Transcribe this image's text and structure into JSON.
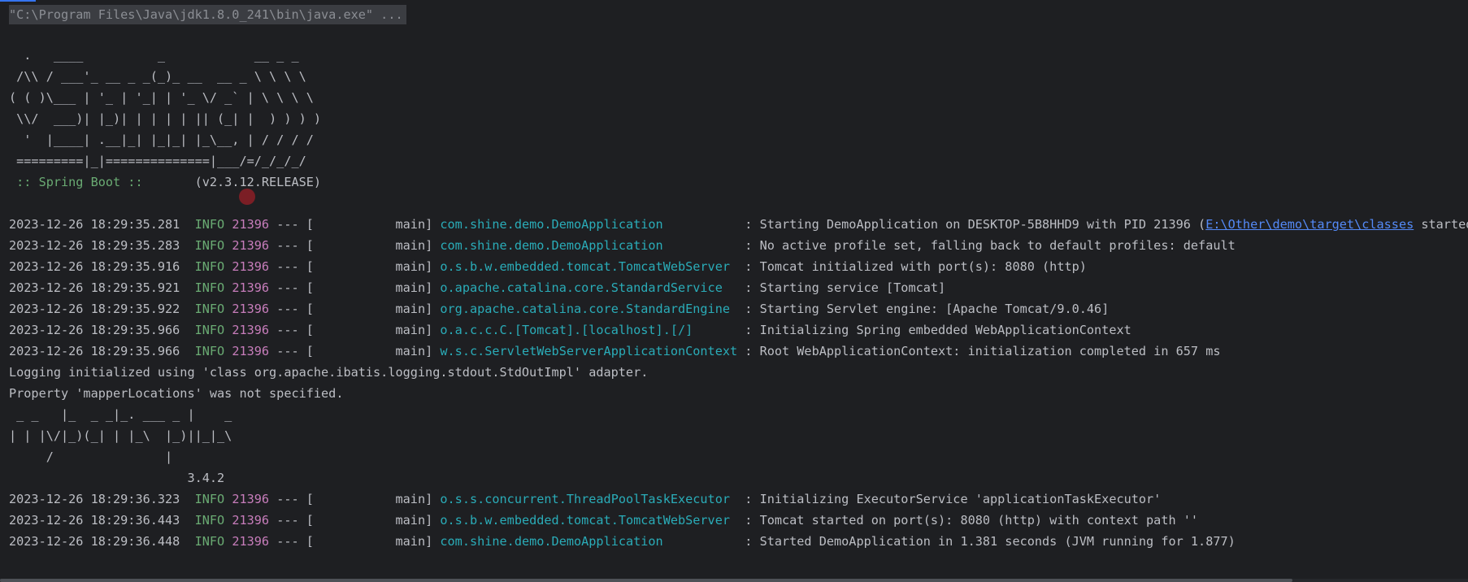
{
  "command": "\"C:\\Program Files\\Java\\jdk1.8.0_241\\bin\\java.exe\" ...",
  "spring_banner": [
    "  .   ____          _            __ _ _",
    " /\\\\ / ___'_ __ _ _(_)_ __  __ _ \\ \\ \\ \\",
    "( ( )\\___ | '_ | '_| | '_ \\/ _` | \\ \\ \\ \\",
    " \\\\/  ___)| |_)| | | | | || (_| |  ) ) ) )",
    "  '  |____| .__|_| |_|_| |_\\__, | / / / /",
    " =========|_|==============|___/=/_/_/_/"
  ],
  "spring_boot": {
    "label": " :: Spring Boot :: ",
    "version": "      (v2.3.12.RELEASE)"
  },
  "logs_a": [
    {
      "ts": "2023-12-26 18:29:35.281",
      "level": "INFO",
      "pid": "21396",
      "sep": " --- [",
      "thread": "           main] ",
      "logger": "com.shine.demo.DemoApplication          ",
      "msg": " : Starting DemoApplication on DESKTOP-5B8HHD9 with PID 21396 (",
      "link": "E:\\Other\\demo\\target\\classes",
      "tail": " started b"
    },
    {
      "ts": "2023-12-26 18:29:35.283",
      "level": "INFO",
      "pid": "21396",
      "sep": " --- [",
      "thread": "           main] ",
      "logger": "com.shine.demo.DemoApplication          ",
      "msg": " : No active profile set, falling back to default profiles: default"
    },
    {
      "ts": "2023-12-26 18:29:35.916",
      "level": "INFO",
      "pid": "21396",
      "sep": " --- [",
      "thread": "           main] ",
      "logger": "o.s.b.w.embedded.tomcat.TomcatWebServer ",
      "msg": " : Tomcat initialized with port(s): 8080 (http)"
    },
    {
      "ts": "2023-12-26 18:29:35.921",
      "level": "INFO",
      "pid": "21396",
      "sep": " --- [",
      "thread": "           main] ",
      "logger": "o.apache.catalina.core.StandardService  ",
      "msg": " : Starting service [Tomcat]"
    },
    {
      "ts": "2023-12-26 18:29:35.922",
      "level": "INFO",
      "pid": "21396",
      "sep": " --- [",
      "thread": "           main] ",
      "logger": "org.apache.catalina.core.StandardEngine ",
      "msg": " : Starting Servlet engine: [Apache Tomcat/9.0.46]"
    },
    {
      "ts": "2023-12-26 18:29:35.966",
      "level": "INFO",
      "pid": "21396",
      "sep": " --- [",
      "thread": "           main] ",
      "logger": "o.a.c.c.C.[Tomcat].[localhost].[/]      ",
      "msg": " : Initializing Spring embedded WebApplicationContext"
    },
    {
      "ts": "2023-12-26 18:29:35.966",
      "level": "INFO",
      "pid": "21396",
      "sep": " --- [",
      "thread": "           main] ",
      "logger": "w.s.c.ServletWebServerApplicationContext",
      "msg": " : Root WebApplicationContext: initialization completed in 657 ms"
    }
  ],
  "plain_lines": [
    "Logging initialized using 'class org.apache.ibatis.logging.stdout.StdOutImpl' adapter.",
    "Property 'mapperLocations' was not specified."
  ],
  "mybatis_banner": [
    " _ _   |_  _ _|_. ___ _ |    _",
    "| | |\\/|_)(_| | |_\\  |_)||_|_\\",
    "     /               |",
    "                        3.4.2"
  ],
  "logs_b": [
    {
      "ts": "2023-12-26 18:29:36.323",
      "level": "INFO",
      "pid": "21396",
      "sep": " --- [",
      "thread": "           main] ",
      "logger": "o.s.s.concurrent.ThreadPoolTaskExecutor ",
      "msg": " : Initializing ExecutorService 'applicationTaskExecutor'"
    },
    {
      "ts": "2023-12-26 18:29:36.443",
      "level": "INFO",
      "pid": "21396",
      "sep": " --- [",
      "thread": "           main] ",
      "logger": "o.s.b.w.embedded.tomcat.TomcatWebServer ",
      "msg": " : Tomcat started on port(s): 8080 (http) with context path ''"
    },
    {
      "ts": "2023-12-26 18:29:36.448",
      "level": "INFO",
      "pid": "21396",
      "sep": " --- [",
      "thread": "           main] ",
      "logger": "com.shine.demo.DemoApplication          ",
      "msg": " : Started DemoApplication in 1.381 seconds (JVM running for 1.877)"
    }
  ],
  "colors": {
    "background": "#1e1f22",
    "text": "#bcbec4",
    "level": "#6aab73",
    "pid": "#c77dbb",
    "logger": "#2aacb8",
    "link": "#548af7"
  }
}
